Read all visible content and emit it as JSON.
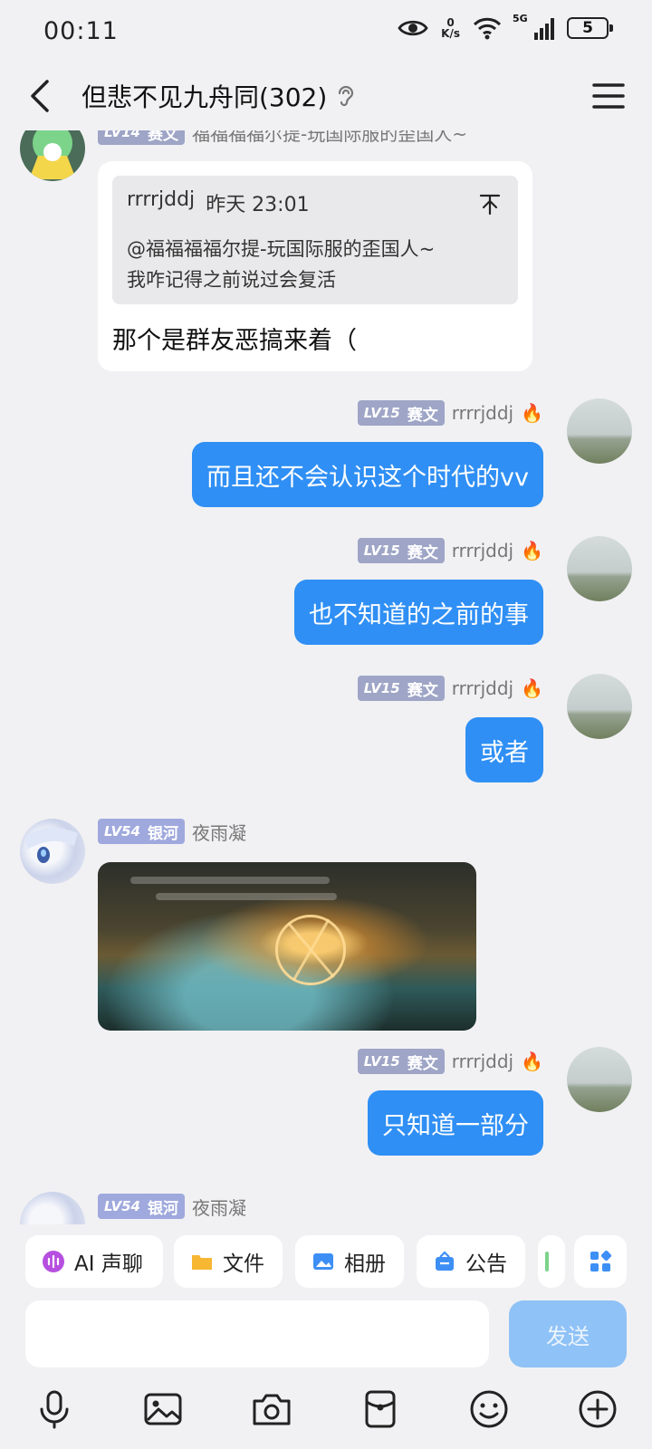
{
  "status": {
    "time": "00:11",
    "net_speed_value": "0",
    "net_speed_unit": "K/s",
    "network": "5G",
    "battery": "5"
  },
  "header": {
    "title": "但悲不见九舟同(302)"
  },
  "messages": {
    "partial_top": {
      "level": "LV14",
      "title": "赛文",
      "nick": "福福福福尔提-玩国际服的歪国人~"
    },
    "quote_msg": {
      "quote_author": "rrrrjddj",
      "quote_time": "昨天 23:01",
      "quote_line1": "@福福福福尔提-玩国际服的歪国人~",
      "quote_line2": "我咋记得之前说过会复活",
      "reply": "那个是群友恶搞来着（"
    },
    "m1": {
      "level": "LV15",
      "title": "赛文",
      "nick": "rrrrjddj",
      "text": "而且还不会认识这个时代的vv"
    },
    "m2": {
      "level": "LV15",
      "title": "赛文",
      "nick": "rrrrjddj",
      "text": "也不知道的之前的事"
    },
    "m3": {
      "level": "LV15",
      "title": "赛文",
      "nick": "rrrrjddj",
      "text": "或者"
    },
    "m4": {
      "level": "LV54",
      "title": "银河",
      "nick": "夜雨凝"
    },
    "m5": {
      "level": "LV15",
      "title": "赛文",
      "nick": "rrrrjddj",
      "text": "只知道一部分"
    },
    "m6": {
      "level": "LV54",
      "title": "银河",
      "nick": "夜雨凝"
    }
  },
  "quick_actions": {
    "ai_voice": "AI 声聊",
    "file": "文件",
    "album": "相册",
    "notice": "公告"
  },
  "input": {
    "placeholder": "",
    "send": "发送"
  },
  "colors": {
    "bubble_self": "#2f8ff4",
    "send_disabled": "#8fc2f6",
    "background": "#f1f1f3"
  }
}
